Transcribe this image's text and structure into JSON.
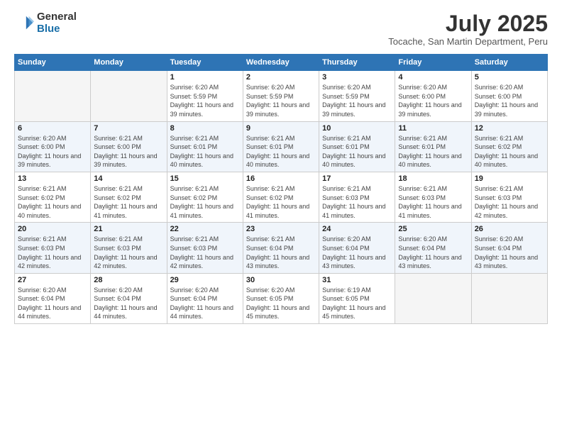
{
  "logo": {
    "general": "General",
    "blue": "Blue"
  },
  "header": {
    "month_year": "July 2025",
    "location": "Tocache, San Martin Department, Peru"
  },
  "weekdays": [
    "Sunday",
    "Monday",
    "Tuesday",
    "Wednesday",
    "Thursday",
    "Friday",
    "Saturday"
  ],
  "weeks": [
    [
      {
        "day": "",
        "empty": true
      },
      {
        "day": "",
        "empty": true
      },
      {
        "day": "1",
        "sunrise": "Sunrise: 6:20 AM",
        "sunset": "Sunset: 5:59 PM",
        "daylight": "Daylight: 11 hours and 39 minutes."
      },
      {
        "day": "2",
        "sunrise": "Sunrise: 6:20 AM",
        "sunset": "Sunset: 5:59 PM",
        "daylight": "Daylight: 11 hours and 39 minutes."
      },
      {
        "day": "3",
        "sunrise": "Sunrise: 6:20 AM",
        "sunset": "Sunset: 5:59 PM",
        "daylight": "Daylight: 11 hours and 39 minutes."
      },
      {
        "day": "4",
        "sunrise": "Sunrise: 6:20 AM",
        "sunset": "Sunset: 6:00 PM",
        "daylight": "Daylight: 11 hours and 39 minutes."
      },
      {
        "day": "5",
        "sunrise": "Sunrise: 6:20 AM",
        "sunset": "Sunset: 6:00 PM",
        "daylight": "Daylight: 11 hours and 39 minutes."
      }
    ],
    [
      {
        "day": "6",
        "sunrise": "Sunrise: 6:20 AM",
        "sunset": "Sunset: 6:00 PM",
        "daylight": "Daylight: 11 hours and 39 minutes."
      },
      {
        "day": "7",
        "sunrise": "Sunrise: 6:21 AM",
        "sunset": "Sunset: 6:00 PM",
        "daylight": "Daylight: 11 hours and 39 minutes."
      },
      {
        "day": "8",
        "sunrise": "Sunrise: 6:21 AM",
        "sunset": "Sunset: 6:01 PM",
        "daylight": "Daylight: 11 hours and 40 minutes."
      },
      {
        "day": "9",
        "sunrise": "Sunrise: 6:21 AM",
        "sunset": "Sunset: 6:01 PM",
        "daylight": "Daylight: 11 hours and 40 minutes."
      },
      {
        "day": "10",
        "sunrise": "Sunrise: 6:21 AM",
        "sunset": "Sunset: 6:01 PM",
        "daylight": "Daylight: 11 hours and 40 minutes."
      },
      {
        "day": "11",
        "sunrise": "Sunrise: 6:21 AM",
        "sunset": "Sunset: 6:01 PM",
        "daylight": "Daylight: 11 hours and 40 minutes."
      },
      {
        "day": "12",
        "sunrise": "Sunrise: 6:21 AM",
        "sunset": "Sunset: 6:02 PM",
        "daylight": "Daylight: 11 hours and 40 minutes."
      }
    ],
    [
      {
        "day": "13",
        "sunrise": "Sunrise: 6:21 AM",
        "sunset": "Sunset: 6:02 PM",
        "daylight": "Daylight: 11 hours and 40 minutes."
      },
      {
        "day": "14",
        "sunrise": "Sunrise: 6:21 AM",
        "sunset": "Sunset: 6:02 PM",
        "daylight": "Daylight: 11 hours and 41 minutes."
      },
      {
        "day": "15",
        "sunrise": "Sunrise: 6:21 AM",
        "sunset": "Sunset: 6:02 PM",
        "daylight": "Daylight: 11 hours and 41 minutes."
      },
      {
        "day": "16",
        "sunrise": "Sunrise: 6:21 AM",
        "sunset": "Sunset: 6:02 PM",
        "daylight": "Daylight: 11 hours and 41 minutes."
      },
      {
        "day": "17",
        "sunrise": "Sunrise: 6:21 AM",
        "sunset": "Sunset: 6:03 PM",
        "daylight": "Daylight: 11 hours and 41 minutes."
      },
      {
        "day": "18",
        "sunrise": "Sunrise: 6:21 AM",
        "sunset": "Sunset: 6:03 PM",
        "daylight": "Daylight: 11 hours and 41 minutes."
      },
      {
        "day": "19",
        "sunrise": "Sunrise: 6:21 AM",
        "sunset": "Sunset: 6:03 PM",
        "daylight": "Daylight: 11 hours and 42 minutes."
      }
    ],
    [
      {
        "day": "20",
        "sunrise": "Sunrise: 6:21 AM",
        "sunset": "Sunset: 6:03 PM",
        "daylight": "Daylight: 11 hours and 42 minutes."
      },
      {
        "day": "21",
        "sunrise": "Sunrise: 6:21 AM",
        "sunset": "Sunset: 6:03 PM",
        "daylight": "Daylight: 11 hours and 42 minutes."
      },
      {
        "day": "22",
        "sunrise": "Sunrise: 6:21 AM",
        "sunset": "Sunset: 6:03 PM",
        "daylight": "Daylight: 11 hours and 42 minutes."
      },
      {
        "day": "23",
        "sunrise": "Sunrise: 6:21 AM",
        "sunset": "Sunset: 6:04 PM",
        "daylight": "Daylight: 11 hours and 43 minutes."
      },
      {
        "day": "24",
        "sunrise": "Sunrise: 6:20 AM",
        "sunset": "Sunset: 6:04 PM",
        "daylight": "Daylight: 11 hours and 43 minutes."
      },
      {
        "day": "25",
        "sunrise": "Sunrise: 6:20 AM",
        "sunset": "Sunset: 6:04 PM",
        "daylight": "Daylight: 11 hours and 43 minutes."
      },
      {
        "day": "26",
        "sunrise": "Sunrise: 6:20 AM",
        "sunset": "Sunset: 6:04 PM",
        "daylight": "Daylight: 11 hours and 43 minutes."
      }
    ],
    [
      {
        "day": "27",
        "sunrise": "Sunrise: 6:20 AM",
        "sunset": "Sunset: 6:04 PM",
        "daylight": "Daylight: 11 hours and 44 minutes."
      },
      {
        "day": "28",
        "sunrise": "Sunrise: 6:20 AM",
        "sunset": "Sunset: 6:04 PM",
        "daylight": "Daylight: 11 hours and 44 minutes."
      },
      {
        "day": "29",
        "sunrise": "Sunrise: 6:20 AM",
        "sunset": "Sunset: 6:04 PM",
        "daylight": "Daylight: 11 hours and 44 minutes."
      },
      {
        "day": "30",
        "sunrise": "Sunrise: 6:20 AM",
        "sunset": "Sunset: 6:05 PM",
        "daylight": "Daylight: 11 hours and 45 minutes."
      },
      {
        "day": "31",
        "sunrise": "Sunrise: 6:19 AM",
        "sunset": "Sunset: 6:05 PM",
        "daylight": "Daylight: 11 hours and 45 minutes."
      },
      {
        "day": "",
        "empty": true
      },
      {
        "day": "",
        "empty": true
      }
    ]
  ]
}
